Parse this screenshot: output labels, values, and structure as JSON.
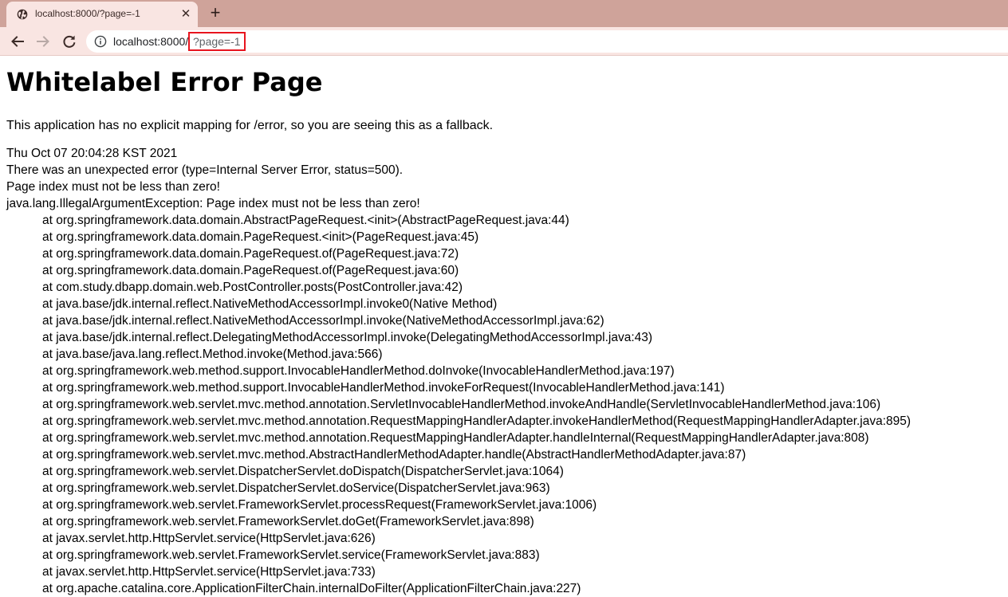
{
  "browser": {
    "tab": {
      "title": "localhost:8000/?page=-1",
      "close_glyph": "✕",
      "favicon": "globe-icon"
    },
    "new_tab_glyph": "+",
    "toolbar": {
      "back_icon": "arrow-left-icon",
      "forward_icon": "arrow-right-icon",
      "reload_icon": "reload-icon"
    },
    "address_bar": {
      "info_icon": "info-icon",
      "host": "localhost:8000/",
      "path": "?page=-1",
      "highlight_color": "#e8141e"
    }
  },
  "page": {
    "title": "Whitelabel Error Page",
    "intro": "This application has no explicit mapping for /error, so you are seeing this as a fallback.",
    "timestamp": "Thu Oct 07 20:04:28 KST 2021",
    "error_summary": "There was an unexpected error (type=Internal Server Error, status=500).",
    "message": "Page index must not be less than zero!",
    "exception": "java.lang.IllegalArgumentException: Page index must not be less than zero!",
    "stack_trace": [
      "at org.springframework.data.domain.AbstractPageRequest.<init>(AbstractPageRequest.java:44)",
      "at org.springframework.data.domain.PageRequest.<init>(PageRequest.java:45)",
      "at org.springframework.data.domain.PageRequest.of(PageRequest.java:72)",
      "at org.springframework.data.domain.PageRequest.of(PageRequest.java:60)",
      "at com.study.dbapp.domain.web.PostController.posts(PostController.java:42)",
      "at java.base/jdk.internal.reflect.NativeMethodAccessorImpl.invoke0(Native Method)",
      "at java.base/jdk.internal.reflect.NativeMethodAccessorImpl.invoke(NativeMethodAccessorImpl.java:62)",
      "at java.base/jdk.internal.reflect.DelegatingMethodAccessorImpl.invoke(DelegatingMethodAccessorImpl.java:43)",
      "at java.base/java.lang.reflect.Method.invoke(Method.java:566)",
      "at org.springframework.web.method.support.InvocableHandlerMethod.doInvoke(InvocableHandlerMethod.java:197)",
      "at org.springframework.web.method.support.InvocableHandlerMethod.invokeForRequest(InvocableHandlerMethod.java:141)",
      "at org.springframework.web.servlet.mvc.method.annotation.ServletInvocableHandlerMethod.invokeAndHandle(ServletInvocableHandlerMethod.java:106)",
      "at org.springframework.web.servlet.mvc.method.annotation.RequestMappingHandlerAdapter.invokeHandlerMethod(RequestMappingHandlerAdapter.java:895)",
      "at org.springframework.web.servlet.mvc.method.annotation.RequestMappingHandlerAdapter.handleInternal(RequestMappingHandlerAdapter.java:808)",
      "at org.springframework.web.servlet.mvc.method.AbstractHandlerMethodAdapter.handle(AbstractHandlerMethodAdapter.java:87)",
      "at org.springframework.web.servlet.DispatcherServlet.doDispatch(DispatcherServlet.java:1064)",
      "at org.springframework.web.servlet.DispatcherServlet.doService(DispatcherServlet.java:963)",
      "at org.springframework.web.servlet.FrameworkServlet.processRequest(FrameworkServlet.java:1006)",
      "at org.springframework.web.servlet.FrameworkServlet.doGet(FrameworkServlet.java:898)",
      "at javax.servlet.http.HttpServlet.service(HttpServlet.java:626)",
      "at org.springframework.web.servlet.FrameworkServlet.service(FrameworkServlet.java:883)",
      "at javax.servlet.http.HttpServlet.service(HttpServlet.java:733)",
      "at org.apache.catalina.core.ApplicationFilterChain.internalDoFilter(ApplicationFilterChain.java:227)"
    ]
  }
}
